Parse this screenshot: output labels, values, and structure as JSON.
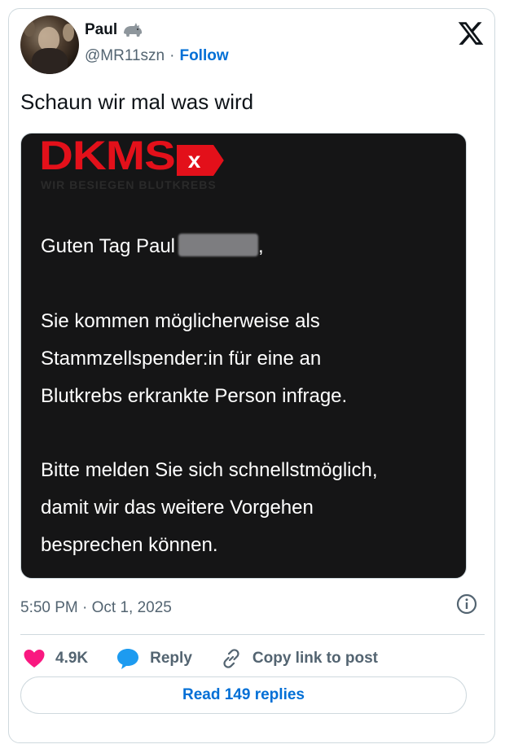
{
  "author": {
    "name": "Paul",
    "handle": "@MR11szn",
    "separator": "·",
    "follow_label": "Follow",
    "badge_icon": "rhino-icon"
  },
  "tweet": {
    "text": "Schaun wir mal was wird",
    "timestamp": "5:50 PM · Oct 1, 2025"
  },
  "media": {
    "logo_text": "DKMS",
    "logo_badge": "x",
    "logo_tagline": "WIR BESIEGEN BLUTKREBS",
    "greeting": "Guten Tag Paul",
    "greeting_suffix": ",",
    "paragraph1": [
      "Sie kommen möglicherweise als",
      "Stammzellspender:in für eine an",
      "Blutkrebs erkrankte Person infrage."
    ],
    "paragraph2": [
      "Bitte melden Sie sich schnellstmöglich,",
      "damit wir das weitere Vorgehen",
      "besprechen können."
    ],
    "brand_color": "#e3101a"
  },
  "actions": {
    "likes": "4.9K",
    "reply_label": "Reply",
    "copy_label": "Copy link to post",
    "read_replies_label": "Read 149 replies"
  },
  "colors": {
    "link": "#006fd6",
    "like": "#f91880",
    "reply": "#1d9bf0",
    "muted": "#536471"
  }
}
